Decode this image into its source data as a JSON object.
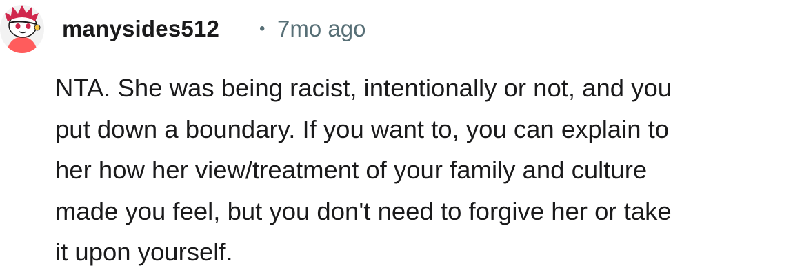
{
  "comment": {
    "author": "manysides512",
    "separator": "•",
    "time_ago": "7mo ago",
    "avatar_icon": "snoo-avatar-icon",
    "body_lines": [
      "NTA. She was being racist, intentionally or not, and you",
      "put down a boundary. If you want to, you can explain to",
      "her how her view/treatment of your family and culture",
      "made you feel, but you don't need to forgive her or take",
      "it upon yourself."
    ]
  },
  "colors": {
    "text": "#1a1a1b",
    "meta": "#576f76",
    "avatar_bg": "#f2f2f2",
    "avatar_hair": "#d0284d",
    "avatar_shirt": "#ff5c5c"
  }
}
